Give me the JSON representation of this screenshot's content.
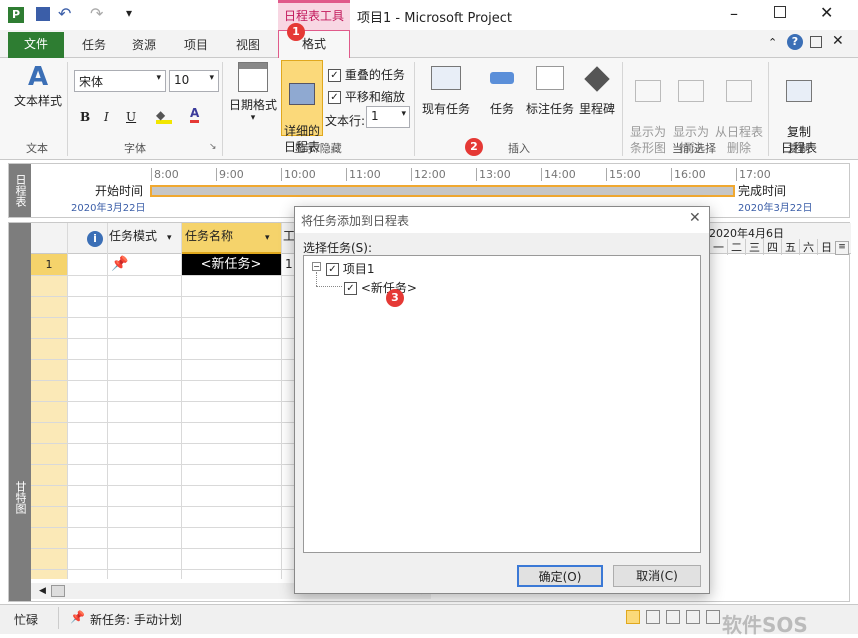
{
  "window": {
    "title": "项目1 - Microsoft Project",
    "context_tab": "日程表工具"
  },
  "tabs": {
    "file": "文件",
    "task": "任务",
    "resource": "资源",
    "project": "项目",
    "view": "视图",
    "format": "格式"
  },
  "font": {
    "name": "宋体",
    "size": "10"
  },
  "ribbon": {
    "text_style": "文本样式",
    "group_text": "文本",
    "group_font": "字体",
    "bold": "B",
    "italic": "I",
    "underline": "U",
    "date_format": "日期格式",
    "detail_timeline": "详细的\n日程表",
    "overlap_tasks": "重叠的任务",
    "pan_zoom": "平移和缩放",
    "text_lines_label": "文本行:",
    "text_lines_value": "1",
    "group_show_hide": "显示/隐藏",
    "existing_tasks": "现有任务",
    "task": "任务",
    "callout_task": "标注任务",
    "milestone": "里程碑",
    "group_insert": "插入",
    "show_as_bar": "显示为\n条形图",
    "show_as_callout": "显示为\n标注",
    "remove_from_timeline": "从日程表\n删除",
    "group_current_selection": "当前选择",
    "copy_timeline": "复制\n日程表",
    "group_copy": "复制"
  },
  "timeline": {
    "side_label": "日程表",
    "start_label": "开始时间",
    "start_date": "2020年3月22日",
    "finish_label": "完成时间",
    "finish_date": "2020年3月22日",
    "hours": [
      "8:00",
      "9:00",
      "10:00",
      "11:00",
      "12:00",
      "13:00",
      "14:00",
      "15:00",
      "16:00",
      "17:00"
    ]
  },
  "grid": {
    "side_label": "甘特图",
    "col_mode": "任务模式",
    "col_name": "任务名称",
    "col_work": "工",
    "row1_id": "1",
    "row1_name": "<新任务>",
    "row1_work": "1",
    "gantt_date": "2020年4月6日",
    "gantt_days": [
      "一",
      "二",
      "三",
      "四",
      "五",
      "六",
      "日"
    ]
  },
  "dialog": {
    "title": "将任务添加到日程表",
    "label": "选择任务(S):",
    "tree_root": "项目1",
    "tree_child": "<新任务>",
    "ok": "确定(O)",
    "cancel": "取消(C)"
  },
  "badges": {
    "b1": "1",
    "b2": "2",
    "b3": "3"
  },
  "status": {
    "mode": "忙碌",
    "task_mode": "新任务: 手动计划"
  },
  "watermark": "软件SOS",
  "colors": {
    "file_tab": "#2e7d32",
    "context": "#e05a8a",
    "gantt_bar": "#f0a830",
    "selected_header": "#f5d36b"
  }
}
